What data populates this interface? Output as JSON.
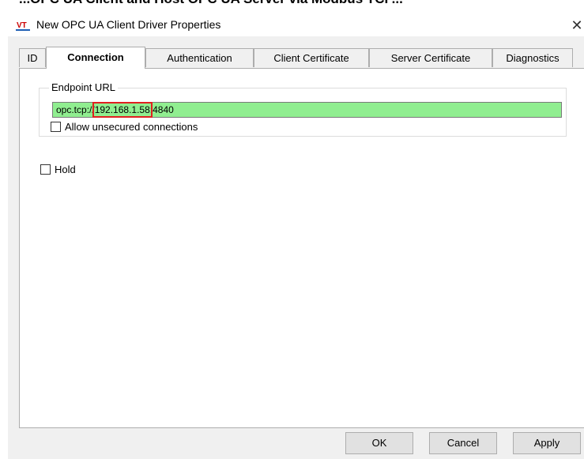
{
  "window": {
    "cropped_header_text": "...OPC UA Client and Host OPC UA Server via Modbus TCP..."
  },
  "dialog": {
    "title": "New OPC UA Client Driver Properties",
    "close_glyph": "✕"
  },
  "tabs": [
    {
      "label": "ID",
      "active": false
    },
    {
      "label": "Connection",
      "active": true
    },
    {
      "label": "Authentication",
      "active": false
    },
    {
      "label": "Client Certificate",
      "active": false
    },
    {
      "label": "Server Certificate",
      "active": false
    },
    {
      "label": "Diagnostics",
      "active": false
    }
  ],
  "connection": {
    "endpoint_group_label": "Endpoint URL",
    "endpoint_prefix": "opc.tcp://",
    "endpoint_host": "192.168.1.58",
    "endpoint_suffix": ":4840",
    "allow_unsecured_label": "Allow unsecured connections",
    "allow_unsecured_checked": false,
    "hold_label": "Hold",
    "hold_checked": false
  },
  "buttons": {
    "ok": "OK",
    "cancel": "Cancel",
    "apply": "Apply"
  },
  "colors": {
    "valid_field": "#90ee90",
    "highlight_box": "#e02020",
    "dialog_bg": "#f0f0f0"
  },
  "icons": {
    "app": "vt-logo-icon",
    "close": "close-icon"
  }
}
